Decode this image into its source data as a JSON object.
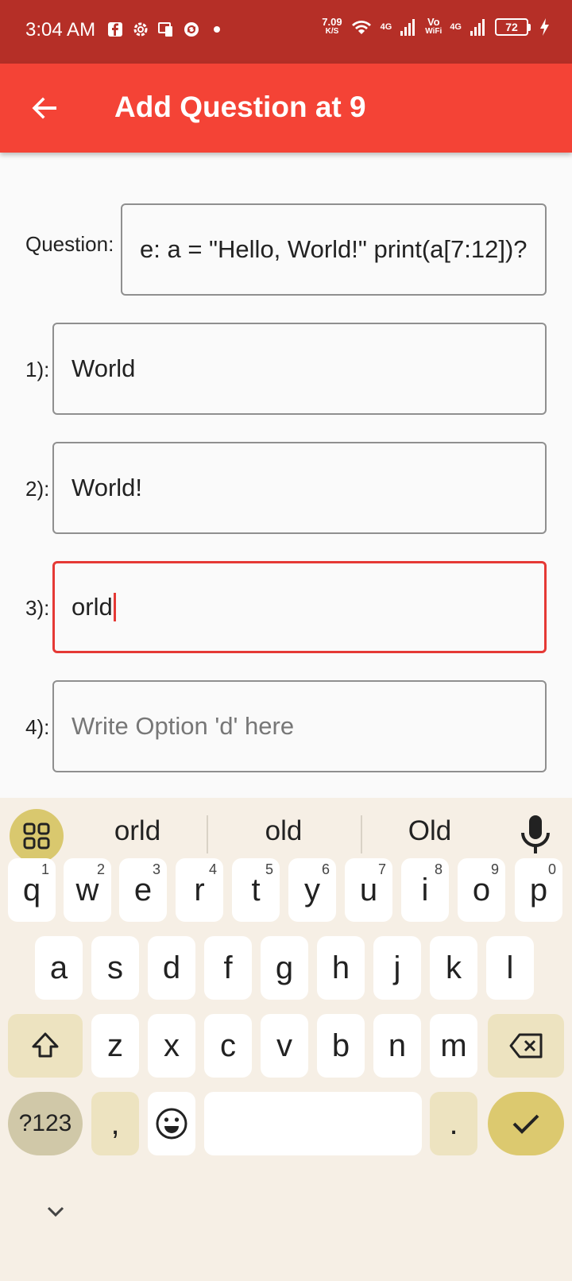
{
  "status_bar": {
    "time": "3:04 AM",
    "speed_value": "7.09",
    "speed_unit": "K/S",
    "net1": "4G",
    "volte": "Vo",
    "volte2": "WiFi",
    "net2": "4G",
    "battery": "72"
  },
  "app_bar": {
    "title": "Add Question at 9"
  },
  "form": {
    "question_label": "Question:",
    "question_value": "e: a = \"Hello, World!\" print(a[7:12])?",
    "options": [
      {
        "label": "1):",
        "value": "World"
      },
      {
        "label": "2):",
        "value": "World!"
      },
      {
        "label": "3):",
        "value": "orld"
      },
      {
        "label": "4):",
        "placeholder": "Write Option 'd' here"
      }
    ]
  },
  "keyboard": {
    "suggestions": [
      "orld",
      "old",
      "Old"
    ],
    "row1": [
      {
        "key": "q",
        "num": "1"
      },
      {
        "key": "w",
        "num": "2"
      },
      {
        "key": "e",
        "num": "3"
      },
      {
        "key": "r",
        "num": "4"
      },
      {
        "key": "t",
        "num": "5"
      },
      {
        "key": "y",
        "num": "6"
      },
      {
        "key": "u",
        "num": "7"
      },
      {
        "key": "i",
        "num": "8"
      },
      {
        "key": "o",
        "num": "9"
      },
      {
        "key": "p",
        "num": "0"
      }
    ],
    "row2": [
      "a",
      "s",
      "d",
      "f",
      "g",
      "h",
      "j",
      "k",
      "l"
    ],
    "row3": [
      "z",
      "x",
      "c",
      "v",
      "b",
      "n",
      "m"
    ],
    "symbols_label": "?123",
    "comma": ",",
    "period": ".",
    "accent_color": "#dcc96f"
  }
}
